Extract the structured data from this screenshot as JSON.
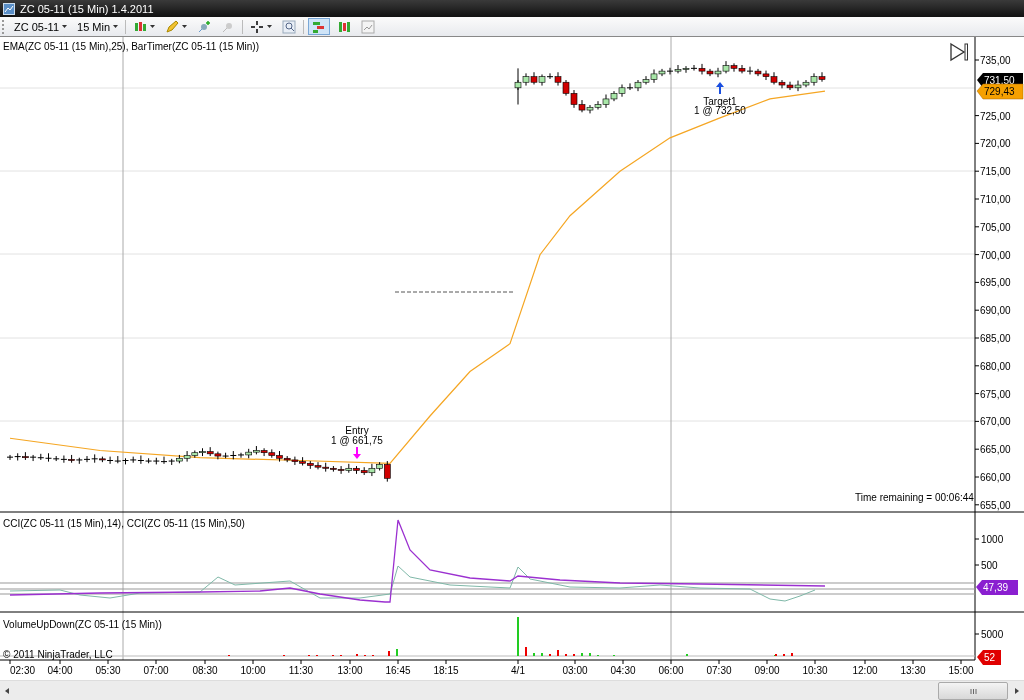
{
  "window": {
    "title": "ZC 05-11 (15 Min)  1.4.2011"
  },
  "toolbar": {
    "instrument": "ZC 05-11",
    "interval": "15 Min"
  },
  "price_panel": {
    "indicator_label": "EMA(ZC 05-11 (15 Min),25), BarTimer(ZC 05-11 (15 Min))",
    "axis_labels": [
      "735,00",
      "725,00",
      "720,00",
      "715,00",
      "710,00",
      "705,00",
      "700,00",
      "695,00",
      "690,00",
      "685,00",
      "680,00",
      "675,00",
      "670,00",
      "665,00",
      "660,00",
      "655,00"
    ],
    "last_price": "731,50",
    "ema_value": "729,43",
    "entry": {
      "label": "Entry",
      "detail": "1 @ 661,75"
    },
    "target": {
      "label": "Target1",
      "detail": "1 @ 732,50"
    },
    "time_remaining": "Time remaining = 00:06:44"
  },
  "cci_panel": {
    "indicator_label": "CCI(ZC 05-11 (15 Min),14), CCI(ZC 05-11 (15 Min),50)",
    "axis_labels": [
      "1000",
      "500"
    ],
    "value": "47,39"
  },
  "volume_panel": {
    "indicator_label": "VolumeUpDown(ZC 05-11 (15 Min))",
    "axis_labels": [
      "5000"
    ],
    "value": "52",
    "copyright": "© 2011 NinjaTrader, LLC"
  },
  "time_axis": {
    "labels": [
      "02:30",
      "04:00",
      "05:30",
      "07:00",
      "08:30",
      "10:00",
      "11:30",
      "13:00",
      "16:45",
      "18:15",
      "4/1",
      "03:00",
      "04:30",
      "06:00",
      "07:30",
      "09:00",
      "10:30",
      "12:00",
      "13:30",
      "15:00"
    ]
  }
}
